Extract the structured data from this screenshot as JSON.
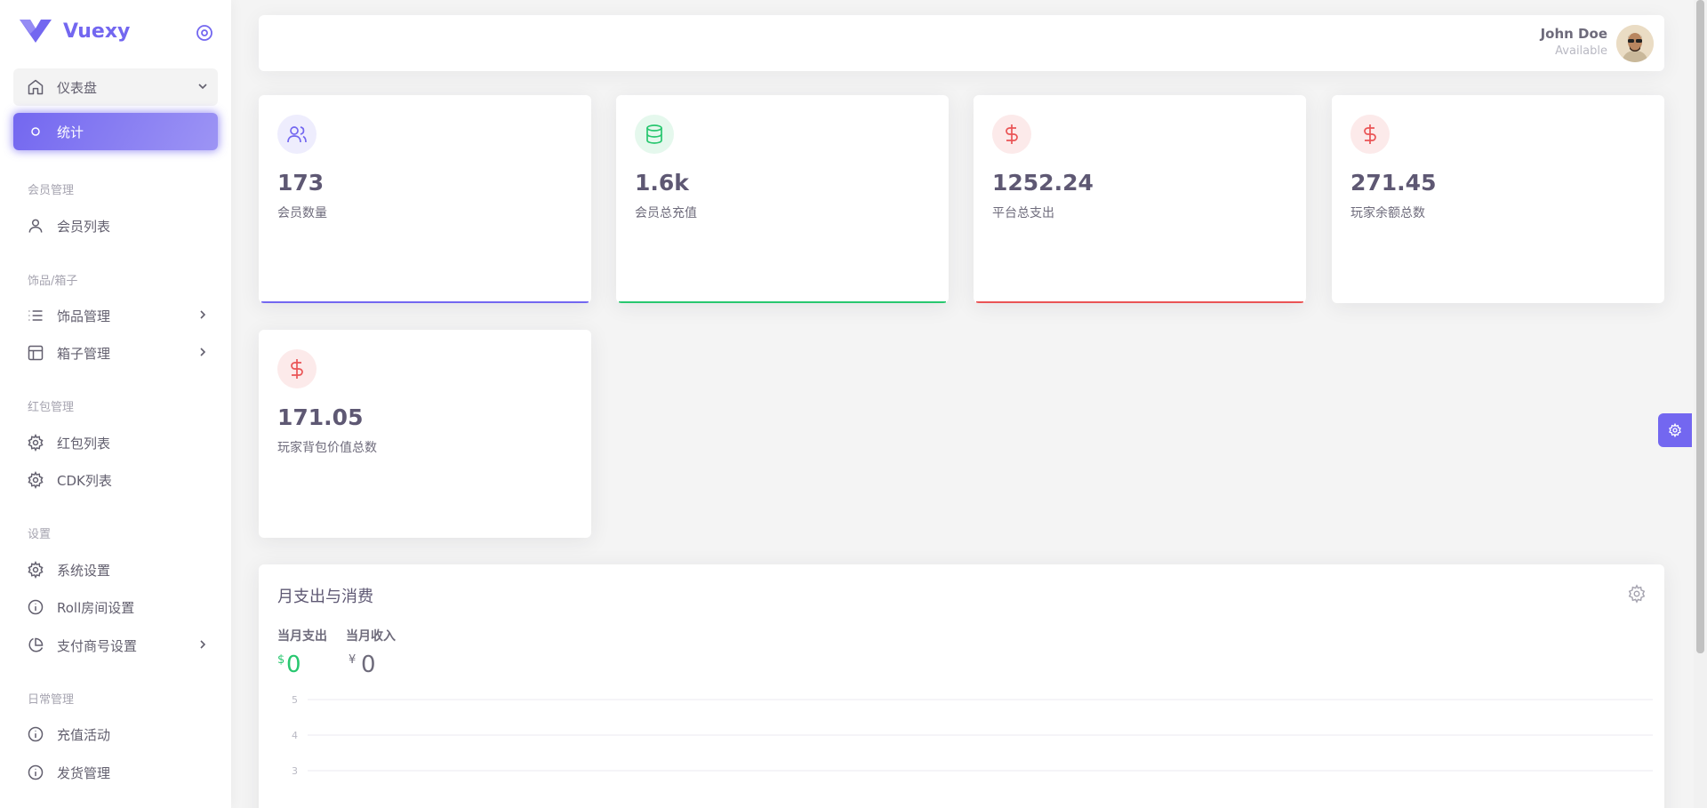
{
  "brand": {
    "name": "Vuexy",
    "color": "#7367f0"
  },
  "sidebar": {
    "dashboard": {
      "label": "仪表盘",
      "icon": "home-icon"
    },
    "stats": {
      "label": "统计",
      "icon": "circle-icon"
    },
    "sections": [
      {
        "header": "会员管理",
        "items": [
          {
            "label": "会员列表",
            "icon": "user-icon",
            "has_children": false
          }
        ]
      },
      {
        "header": "饰品/箱子",
        "items": [
          {
            "label": "饰品管理",
            "icon": "list-icon",
            "has_children": true
          },
          {
            "label": "箱子管理",
            "icon": "layout-icon",
            "has_children": true
          }
        ]
      },
      {
        "header": "红包管理",
        "items": [
          {
            "label": "红包列表",
            "icon": "settings-icon",
            "has_children": false
          },
          {
            "label": "CDK列表",
            "icon": "settings-icon",
            "has_children": false
          }
        ]
      },
      {
        "header": "设置",
        "items": [
          {
            "label": "系统设置",
            "icon": "settings-icon",
            "has_children": false
          },
          {
            "label": "Roll房间设置",
            "icon": "info-icon",
            "has_children": false
          },
          {
            "label": "支付商号设置",
            "icon": "pie-chart-icon",
            "has_children": true
          }
        ]
      },
      {
        "header": "日常管理",
        "items": [
          {
            "label": "充值活动",
            "icon": "info-icon",
            "has_children": false
          },
          {
            "label": "发货管理",
            "icon": "info-icon",
            "has_children": false
          }
        ]
      }
    ]
  },
  "user": {
    "name": "John Doe",
    "status": "Available"
  },
  "stats": [
    {
      "value": "173",
      "label": "会员数量",
      "icon": "users-icon",
      "color": "#7367f0",
      "bg": "#eeedfd"
    },
    {
      "value": "1.6k",
      "label": "会员总充值",
      "icon": "database-icon",
      "color": "#28c76f",
      "bg": "#e5f8ed"
    },
    {
      "value": "1252.24",
      "label": "平台总支出",
      "icon": "dollar-icon",
      "color": "#ea5455",
      "bg": "#fceaea"
    },
    {
      "value": "271.45",
      "label": "玩家余额总数",
      "icon": "dollar-icon",
      "color": "#ea5455",
      "bg": "#fceaea"
    },
    {
      "value": "171.05",
      "label": "玩家背包价值总数",
      "icon": "dollar-icon",
      "color": "#ea5455",
      "bg": "#fceaea"
    }
  ],
  "monthly": {
    "title": "月支出与消费",
    "expense_label": "当月支出",
    "expense_currency": "$",
    "expense_value": "0",
    "income_label": "当月收入",
    "income_currency": "¥",
    "income_value": "0"
  },
  "chart_data": {
    "type": "bar",
    "title": "",
    "categories": [],
    "series": [],
    "yticks_visible": [
      "5",
      "4",
      "3"
    ],
    "ylim": [
      0,
      5
    ],
    "grid": true
  }
}
